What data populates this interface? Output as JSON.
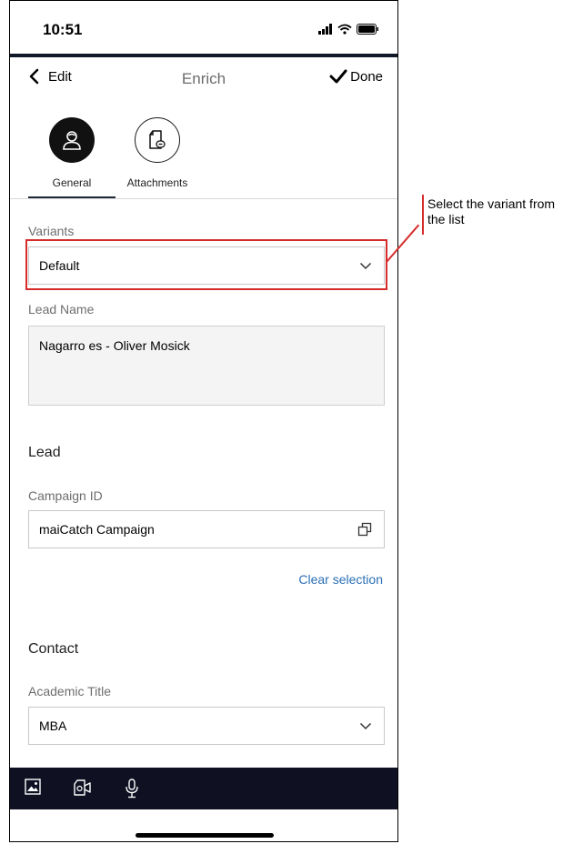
{
  "status_bar": {
    "time": "10:51"
  },
  "nav": {
    "back_label": "Edit",
    "title": "Enrich",
    "done_label": "Done"
  },
  "tabs": [
    {
      "label": "General",
      "icon": "person-icon",
      "active": true
    },
    {
      "label": "Attachments",
      "icon": "attachment-icon",
      "active": false
    }
  ],
  "form": {
    "variants": {
      "label": "Variants",
      "value": "Default"
    },
    "lead_name": {
      "label": "Lead Name",
      "value": "Nagarro es - Oliver  Mosick"
    },
    "lead_section": "Lead",
    "campaign": {
      "label": "Campaign ID",
      "value": "maiCatch Campaign",
      "clear_label": "Clear selection"
    },
    "contact_section": "Contact",
    "academic_title": {
      "label": "Academic Title",
      "value": "MBA"
    }
  },
  "toolbar": {
    "icons": [
      "image-icon",
      "video-icon",
      "microphone-icon"
    ]
  },
  "annotation": {
    "text": "Select the variant from the list",
    "color": "#d62b2b"
  },
  "colors": {
    "link": "#2a6fb5",
    "dark_bar": "#0f1123"
  }
}
